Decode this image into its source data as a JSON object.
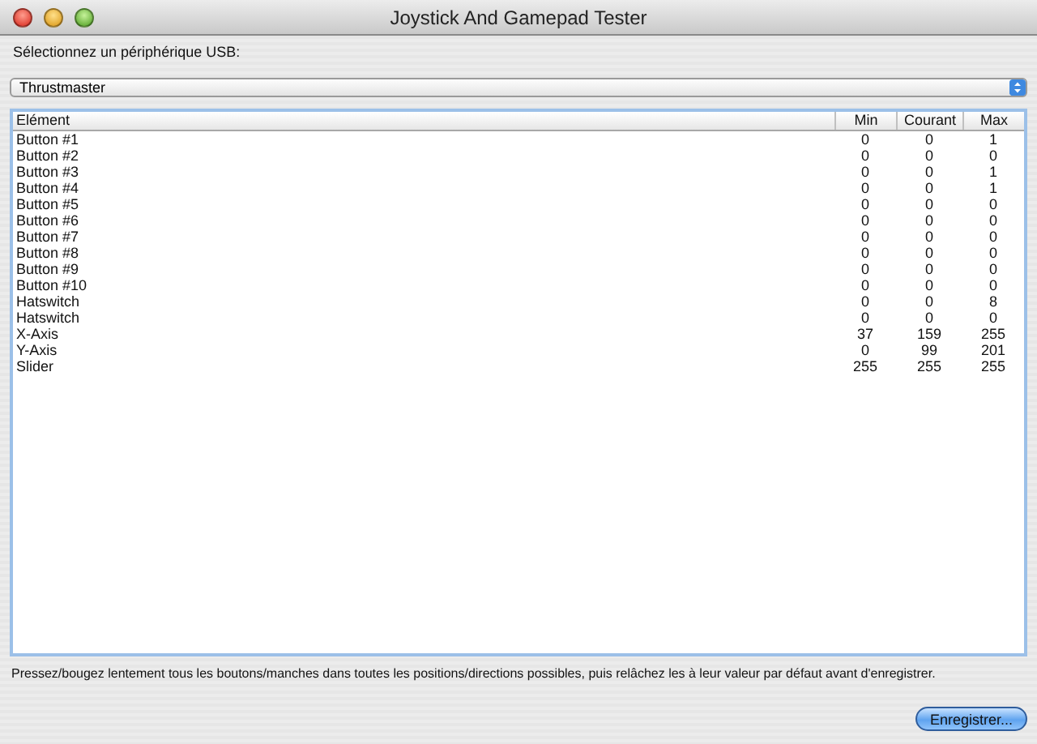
{
  "window": {
    "title": "Joystick And Gamepad Tester"
  },
  "device_label": "Sélectionnez un périphérique USB:",
  "device_popup": {
    "value": "Thrustmaster"
  },
  "table": {
    "columns": [
      "Elément",
      "Min",
      "Courant",
      "Max"
    ],
    "rows": [
      [
        "Button #1",
        "0",
        "0",
        "1"
      ],
      [
        "Button #2",
        "0",
        "0",
        "0"
      ],
      [
        "Button #3",
        "0",
        "0",
        "1"
      ],
      [
        "Button #4",
        "0",
        "0",
        "1"
      ],
      [
        "Button #5",
        "0",
        "0",
        "0"
      ],
      [
        "Button #6",
        "0",
        "0",
        "0"
      ],
      [
        "Button #7",
        "0",
        "0",
        "0"
      ],
      [
        "Button #8",
        "0",
        "0",
        "0"
      ],
      [
        "Button #9",
        "0",
        "0",
        "0"
      ],
      [
        "Button #10",
        "0",
        "0",
        "0"
      ],
      [
        "Hatswitch",
        "0",
        "0",
        "8"
      ],
      [
        "Hatswitch",
        "0",
        "0",
        "0"
      ],
      [
        "X-Axis",
        "37",
        "159",
        "255"
      ],
      [
        "Y-Axis",
        "0",
        "99",
        "201"
      ],
      [
        "Slider",
        "255",
        "255",
        "255"
      ]
    ]
  },
  "instructions": "Pressez/bougez lentement tous les boutons/manches dans toutes les positions/directions possibles, puis relâchez les à leur valeur par défaut avant d'enregistrer.",
  "buttons": [
    {
      "label": "Enregistrer..."
    }
  ]
}
